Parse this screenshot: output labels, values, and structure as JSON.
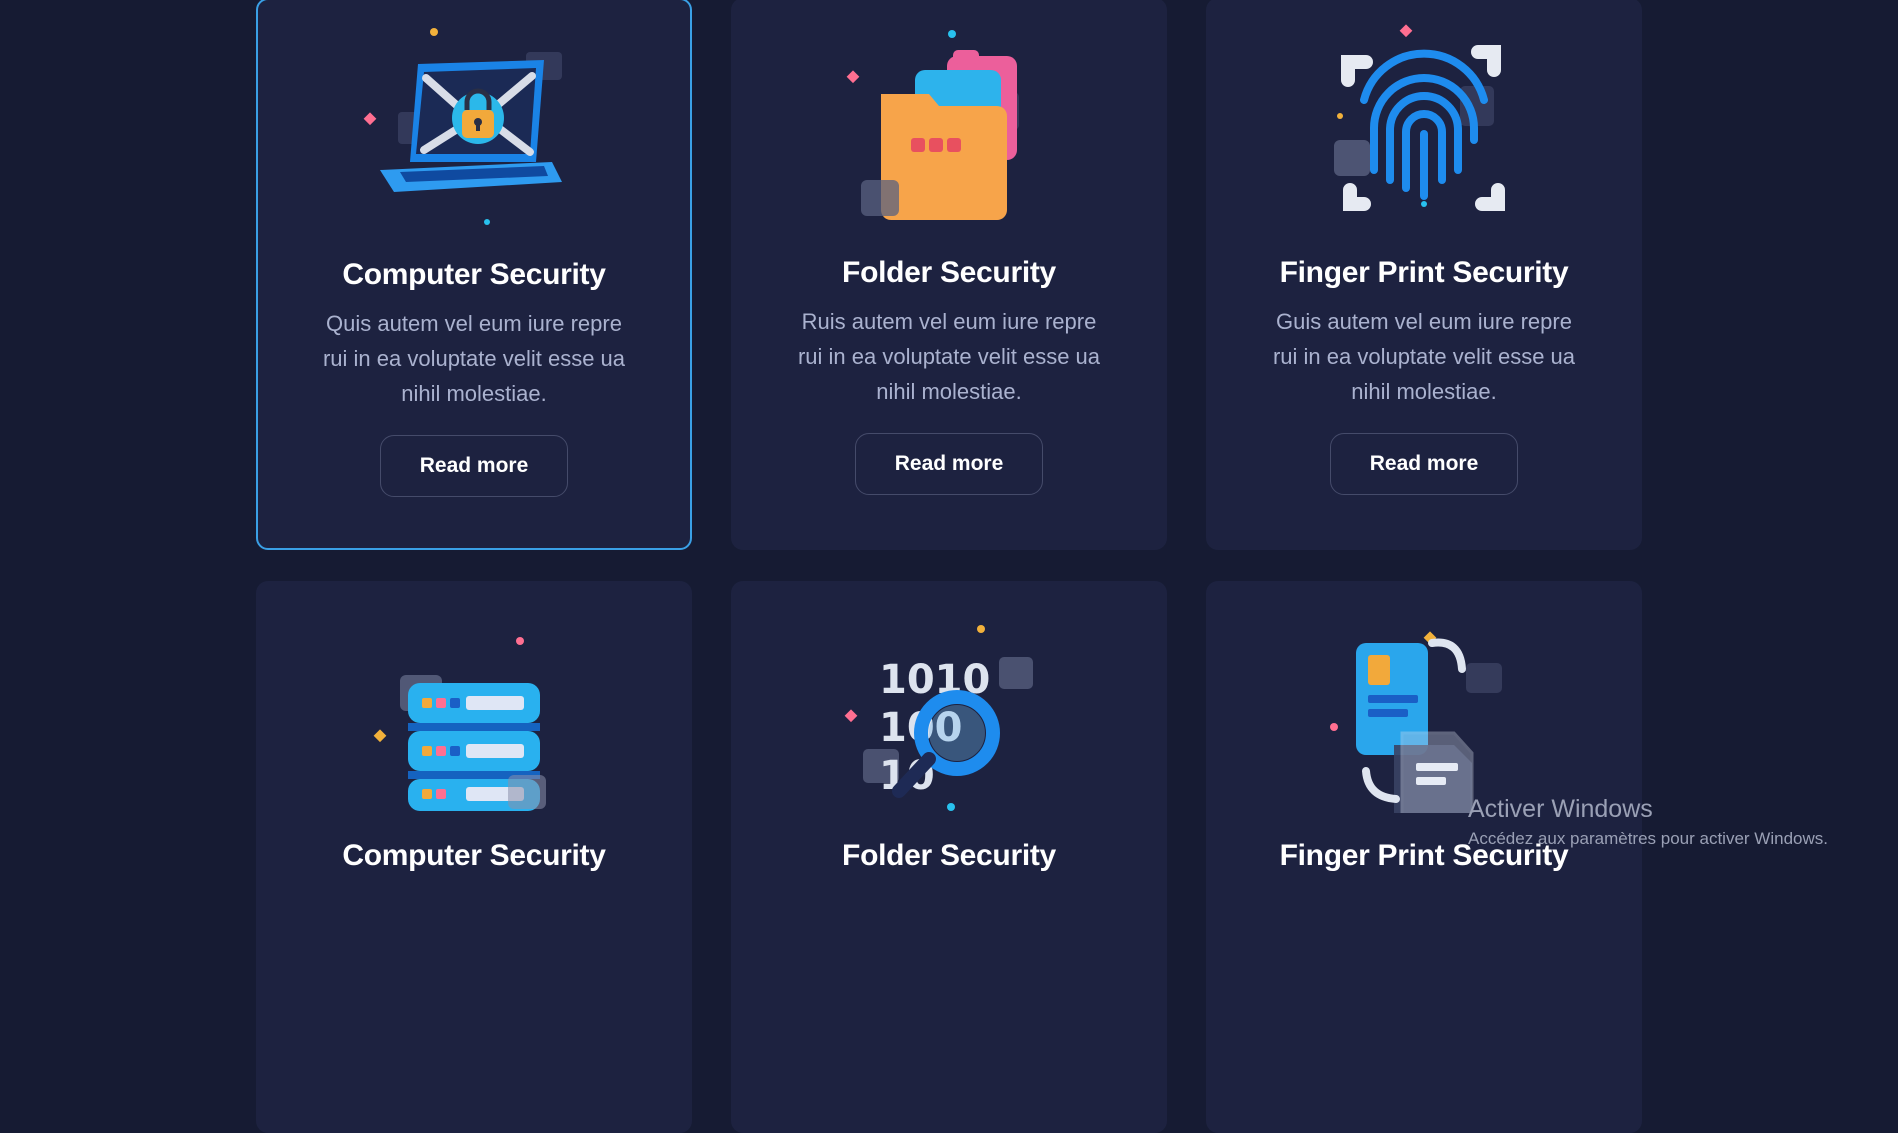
{
  "cards": [
    {
      "icon": "laptop-lock-icon",
      "title": "Computer Security",
      "text": "Quis autem vel eum iure repre rui in ea voluptate velit esse ua nihil molestiae.",
      "button": "Read more"
    },
    {
      "icon": "folder-icon",
      "title": "Folder Security",
      "text": "Ruis autem vel eum iure repre rui in ea voluptate velit esse ua nihil molestiae.",
      "button": "Read more"
    },
    {
      "icon": "fingerprint-icon",
      "title": "Finger Print Security",
      "text": "Guis autem vel eum iure repre rui in ea voluptate velit esse ua nihil molestiae.",
      "button": "Read more"
    },
    {
      "icon": "server-icon",
      "title": "Computer Security"
    },
    {
      "icon": "binary-search-icon",
      "title": "Folder Security"
    },
    {
      "icon": "document-sync-icon",
      "title": "Finger Print Security"
    }
  ],
  "watermark": {
    "title": "Activer Windows",
    "subtitle": "Accédez aux paramètres pour activer Windows."
  },
  "colors": {
    "background": "#161b33",
    "card": "#1d2240",
    "active_border": "#3aa0e6",
    "body_text": "#aab2cf"
  }
}
